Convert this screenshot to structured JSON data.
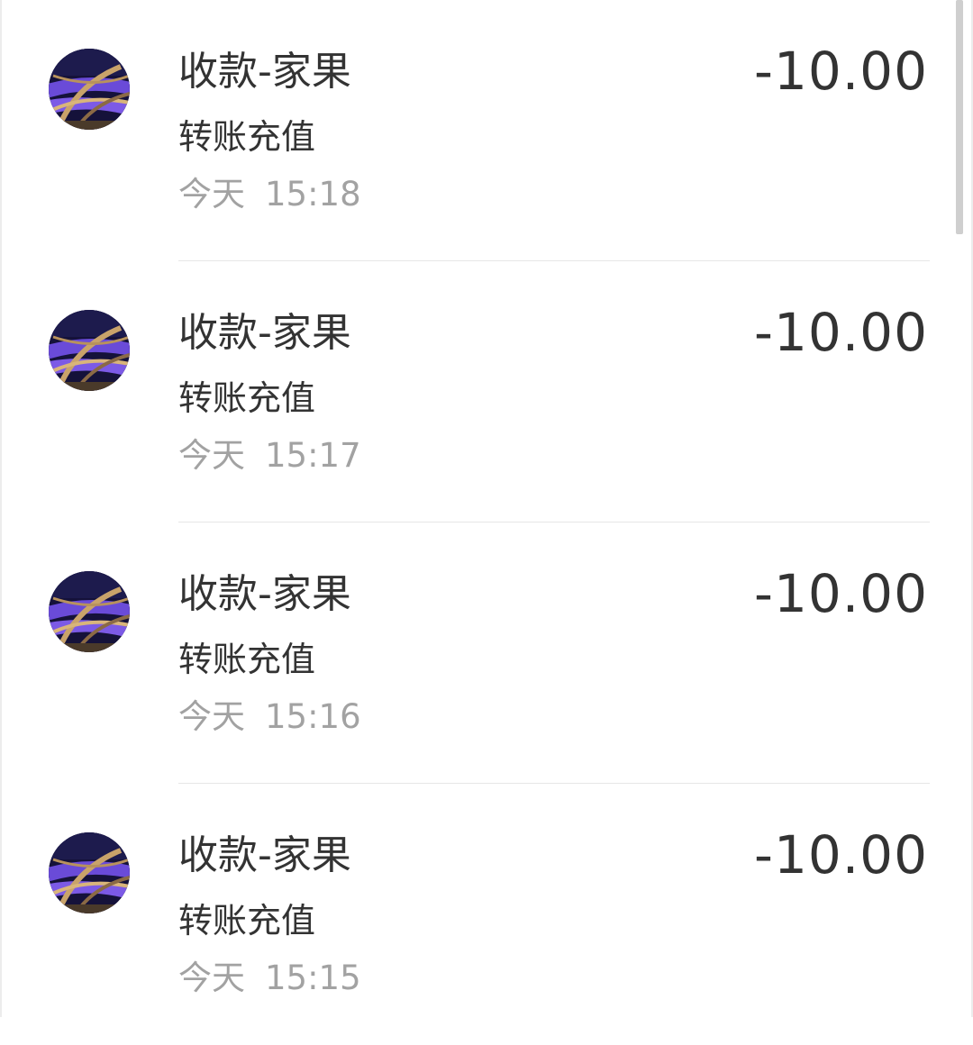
{
  "transactions": [
    {
      "title": "收款-家果",
      "description": "转账充值",
      "day": "今天",
      "time": "15:18",
      "amount": "-10.00"
    },
    {
      "title": "收款-家果",
      "description": "转账充值",
      "day": "今天",
      "time": "15:17",
      "amount": "-10.00"
    },
    {
      "title": "收款-家果",
      "description": "转账充值",
      "day": "今天",
      "time": "15:16",
      "amount": "-10.00"
    },
    {
      "title": "收款-家果",
      "description": "转账充值",
      "day": "今天",
      "time": "15:15",
      "amount": "-10.00"
    }
  ],
  "avatar_icon": "city-highway-night-photo",
  "colors": {
    "primary_text": "#333333",
    "secondary_text": "#a2a2a2",
    "divider": "#e6e6e6",
    "background": "#ffffff"
  }
}
